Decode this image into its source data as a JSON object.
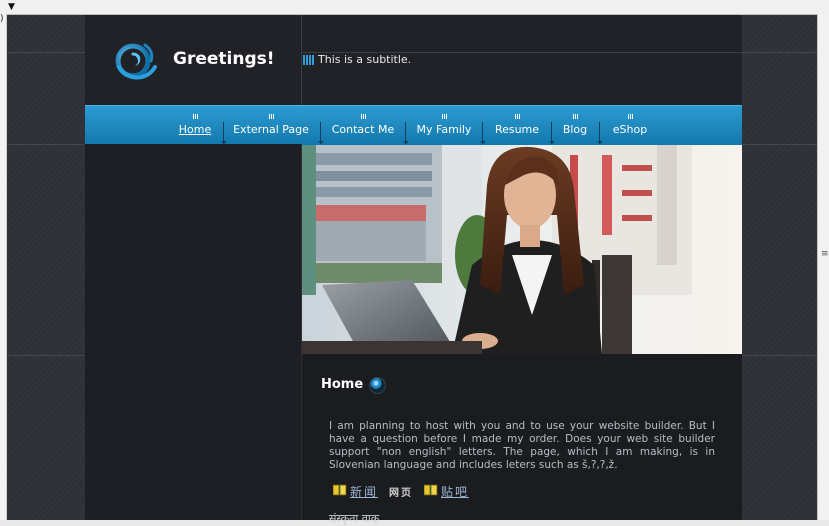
{
  "site": {
    "title": "Greetings!",
    "subtitle": "This is a subtitle."
  },
  "nav": {
    "items": [
      {
        "label": "Home",
        "active": true
      },
      {
        "label": "External Page",
        "active": false
      },
      {
        "label": "Contact Me",
        "active": false
      },
      {
        "label": "My Family",
        "active": false
      },
      {
        "label": "Resume",
        "active": false
      },
      {
        "label": "Blog",
        "active": false
      },
      {
        "label": "eShop",
        "active": false
      }
    ]
  },
  "content": {
    "heading": "Home",
    "body": "I am planning to host with you and to use your website builder. But I have a question before I made my order. Does your web site builder support \"non english\" letters. The page, which I am making, is in Slovenian language and includes leters such as š,?,?,ž.",
    "links": {
      "news": "新闻",
      "web": "网页",
      "tieba": "贴吧"
    },
    "footer_text": "संस्कृता वाक्"
  },
  "colors": {
    "nav_blue": "#1f8cc4",
    "accent": "#2f9ed6",
    "background": "#2d3037",
    "container": "#1d1f24"
  },
  "icons": {
    "logo": "swirl-logo-icon",
    "bullet": "blue-orb-icon",
    "book": "book-icon"
  }
}
